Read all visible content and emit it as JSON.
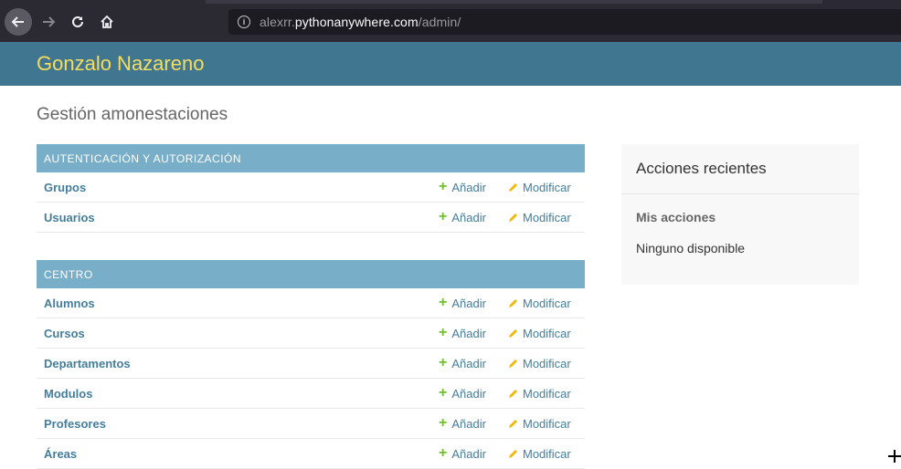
{
  "browser": {
    "url_host_prefix": "alexrr.",
    "url_host_domain": "pythonanywhere.com",
    "url_path": "/admin/"
  },
  "header": {
    "branding": "Gonzalo Nazareno"
  },
  "page": {
    "title": "Gestión amonestaciones"
  },
  "modules": [
    {
      "caption": "AUTENTICACIÓN Y AUTORIZACIÓN",
      "rows": [
        {
          "model": "Grupos",
          "add": "Añadir",
          "change": "Modificar"
        },
        {
          "model": "Usuarios",
          "add": "Añadir",
          "change": "Modificar"
        }
      ]
    },
    {
      "caption": "CENTRO",
      "rows": [
        {
          "model": "Alumnos",
          "add": "Añadir",
          "change": "Modificar"
        },
        {
          "model": "Cursos",
          "add": "Añadir",
          "change": "Modificar"
        },
        {
          "model": "Departamentos",
          "add": "Añadir",
          "change": "Modificar"
        },
        {
          "model": "Modulos",
          "add": "Añadir",
          "change": "Modificar"
        },
        {
          "model": "Profesores",
          "add": "Añadir",
          "change": "Modificar"
        },
        {
          "model": "Áreas",
          "add": "Añadir",
          "change": "Modificar"
        }
      ]
    }
  ],
  "recent_actions": {
    "title": "Acciones recientes",
    "subtitle": "Mis acciones",
    "empty": "Ninguno disponible"
  },
  "colors": {
    "header_bg": "#417690",
    "branding": "#f5dd5d",
    "caption_bg": "#79aec8",
    "link": "#447e9b",
    "add_icon": "#70bf2b",
    "change_icon": "#efb80b"
  }
}
